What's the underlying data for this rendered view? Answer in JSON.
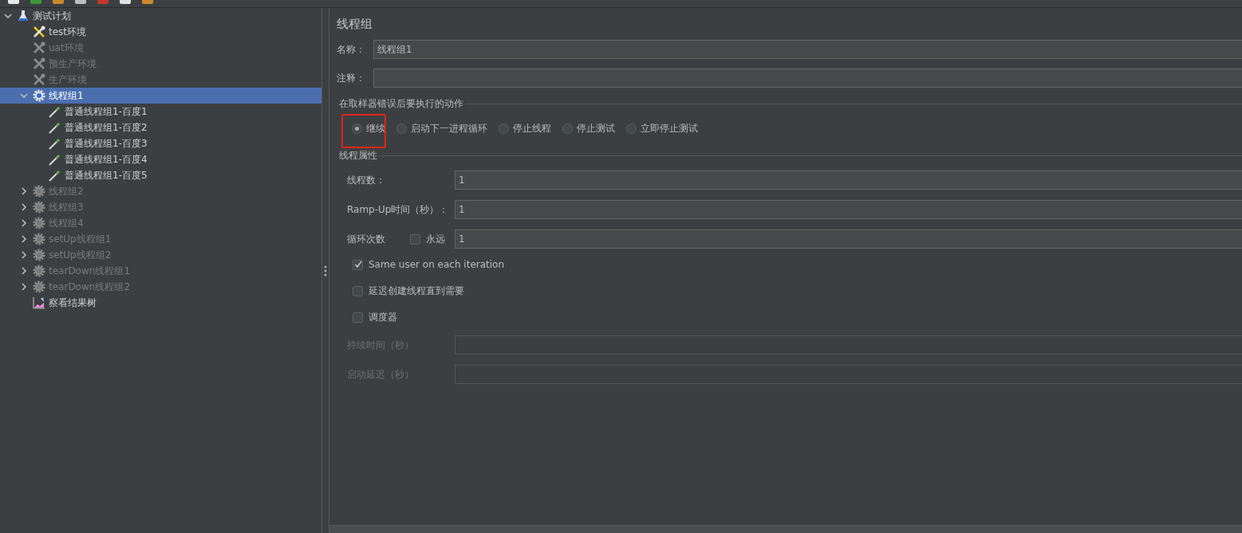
{
  "tree": [
    {
      "label": "测试计划",
      "kind": "plan",
      "enabled": true,
      "selected": false,
      "expanded": true,
      "children": [
        {
          "label": "test环境",
          "kind": "config",
          "enabled": true,
          "selected": false
        },
        {
          "label": "uat环境",
          "kind": "config",
          "enabled": false,
          "selected": false
        },
        {
          "label": "预生产环境",
          "kind": "config",
          "enabled": false,
          "selected": false
        },
        {
          "label": "生产环境",
          "kind": "config",
          "enabled": false,
          "selected": false
        },
        {
          "label": "线程组1",
          "kind": "threadgroup",
          "enabled": true,
          "selected": true,
          "expanded": true,
          "children": [
            {
              "label": "普通线程组1-百度1",
              "kind": "sampler",
              "enabled": true,
              "selected": false
            },
            {
              "label": "普通线程组1-百度2",
              "kind": "sampler",
              "enabled": true,
              "selected": false
            },
            {
              "label": "普通线程组1-百度3",
              "kind": "sampler",
              "enabled": true,
              "selected": false
            },
            {
              "label": "普通线程组1-百度4",
              "kind": "sampler",
              "enabled": true,
              "selected": false
            },
            {
              "label": "普通线程组1-百度5",
              "kind": "sampler",
              "enabled": true,
              "selected": false
            }
          ]
        },
        {
          "label": "线程组2",
          "kind": "threadgroup",
          "enabled": false,
          "selected": false,
          "expanded": false
        },
        {
          "label": "线程组3",
          "kind": "threadgroup",
          "enabled": false,
          "selected": false,
          "expanded": false
        },
        {
          "label": "线程组4",
          "kind": "threadgroup",
          "enabled": false,
          "selected": false,
          "expanded": false
        },
        {
          "label": "setUp线程组1",
          "kind": "threadgroup",
          "enabled": false,
          "selected": false,
          "expanded": false
        },
        {
          "label": "setUp线程组2",
          "kind": "threadgroup",
          "enabled": false,
          "selected": false,
          "expanded": false
        },
        {
          "label": "tearDown线程组1",
          "kind": "threadgroup",
          "enabled": false,
          "selected": false,
          "expanded": false
        },
        {
          "label": "tearDown线程组2",
          "kind": "threadgroup",
          "enabled": false,
          "selected": false,
          "expanded": false
        },
        {
          "label": "察看结果树",
          "kind": "listener",
          "enabled": true,
          "selected": false
        }
      ]
    }
  ],
  "panel": {
    "title": "线程组",
    "name": {
      "label": "名称：",
      "value": "线程组1"
    },
    "comment": {
      "label": "注释："
    },
    "error_action": {
      "legend": "在取样器错误后要执行的动作",
      "options": [
        {
          "label": "继续",
          "selected": true,
          "highlighted": true
        },
        {
          "label": "启动下一进程循环",
          "selected": false,
          "highlighted": false
        },
        {
          "label": "停止线程",
          "selected": false,
          "highlighted": false
        },
        {
          "label": "停止测试",
          "selected": false,
          "highlighted": false
        },
        {
          "label": "立即停止测试",
          "selected": false,
          "highlighted": false
        }
      ]
    },
    "thread_props": {
      "legend": "线程属性",
      "threads": {
        "label": "线程数：",
        "value": "1"
      },
      "ramp_up": {
        "label": "Ramp-Up时间（秒）：",
        "value": "1"
      },
      "loops": {
        "label": "循环次数",
        "forever": {
          "label": "永远",
          "checked": false
        },
        "value": "1"
      },
      "checks": [
        {
          "label": "Same user on each iteration",
          "checked": true
        },
        {
          "label": "延迟创建线程直到需要",
          "checked": false
        },
        {
          "label": "调度器",
          "checked": false
        }
      ],
      "duration": {
        "label": "持续时间（秒）",
        "disabled": true
      },
      "delay": {
        "label": "启动延迟（秒）",
        "disabled": true
      }
    }
  }
}
